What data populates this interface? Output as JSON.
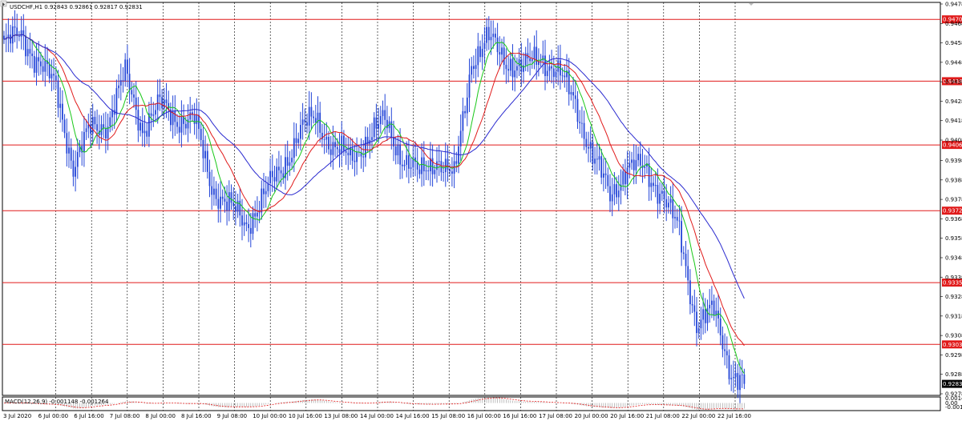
{
  "header": {
    "label": "USDCHF,H1  0.92843 0.92861 0.92817 0.92831"
  },
  "macd_header": {
    "label": "MACD(12,26,9) -0.001148 -0.001264"
  },
  "colors": {
    "candles": "#2547d8",
    "ma_fast": "#19c819",
    "ma_mid": "#e01a1a",
    "ma_slow": "#2a2acf",
    "levels": "#e01a1a",
    "grid": "#000000",
    "macd_hist": "#b0b0b0",
    "macd_signal": "#e01a1a"
  },
  "chart_data": [
    {
      "type": "candlestick",
      "title": "USDCHF,H1",
      "ohlc_last": {
        "open": 0.92843,
        "high": 0.92861,
        "low": 0.92817,
        "close": 0.92831
      },
      "ylim": [
        0.9278,
        0.94785
      ],
      "y_ticks": [
        0.94785,
        0.94685,
        0.94585,
        0.94485,
        0.94385,
        0.94285,
        0.94185,
        0.94085,
        0.9398,
        0.9388,
        0.9378,
        0.9368,
        0.9358,
        0.9348,
        0.9338,
        0.9328,
        0.9318,
        0.9308,
        0.9298,
        0.9288,
        0.9278
      ],
      "y_tick_labels": [
        "0.94785",
        "0.94685",
        "0.94585",
        "0.94485",
        "0.94385",
        "0.94285",
        "0.94185",
        "0.94085",
        "0.93980",
        "0.93880",
        "0.93780",
        "0.93680",
        "0.93580",
        "0.93480",
        "0.93380",
        "0.93280",
        "0.93180",
        "0.93080",
        "0.92980",
        "0.92880",
        "0.92780"
      ],
      "x_tick_labels": [
        "3 Jul 2020",
        "6 Jul 00:00",
        "6 Jul 16:00",
        "7 Jul 08:00",
        "8 Jul 00:00",
        "8 Jul 16:00",
        "9 Jul 08:00",
        "10 Jul 00:00",
        "10 Jul 16:00",
        "13 Jul 08:00",
        "14 Jul 00:00",
        "14 Jul 16:00",
        "15 Jul 08:00",
        "16 Jul 00:00",
        "16 Jul 16:00",
        "17 Jul 08:00",
        "20 Jul 00:00",
        "20 Jul 16:00",
        "21 Jul 08:00",
        "22 Jul 00:00",
        "22 Jul 16:00"
      ],
      "horizontal_levels": [
        {
          "value": 0.94706,
          "label": "0.94706"
        },
        {
          "value": 0.94388,
          "label": "0.94388"
        },
        {
          "value": 0.9406,
          "label": "0.94060"
        },
        {
          "value": 0.93722,
          "label": "0.93722"
        },
        {
          "value": 0.93352,
          "label": "0.93352"
        },
        {
          "value": 0.93034,
          "label": "0.93034"
        }
      ],
      "current_price": {
        "value": 0.92831,
        "label": "0.92831"
      },
      "close_path": {
        "t": [
          0,
          8,
          16,
          24,
          32,
          40,
          48,
          56,
          64,
          72,
          80,
          88,
          96,
          104,
          112,
          120,
          128,
          136,
          144,
          152,
          160,
          168,
          176,
          184,
          192,
          200,
          208,
          216,
          224,
          232,
          240,
          248,
          256,
          264,
          272,
          280,
          288,
          296,
          304,
          312,
          320,
          328,
          336,
          342
        ],
        "close": [
          0.9458,
          0.9462,
          0.9449,
          0.9435,
          0.9395,
          0.9414,
          0.9418,
          0.9442,
          0.9415,
          0.9426,
          0.942,
          0.9418,
          0.9385,
          0.9374,
          0.9365,
          0.938,
          0.9393,
          0.9412,
          0.942,
          0.9405,
          0.9398,
          0.941,
          0.9418,
          0.94,
          0.939,
          0.94,
          0.9388,
          0.945,
          0.946,
          0.945,
          0.9445,
          0.9452,
          0.9443,
          0.9428,
          0.94,
          0.938,
          0.9395,
          0.9393,
          0.9382,
          0.936,
          0.9315,
          0.932,
          0.929,
          0.9283
        ]
      },
      "ma_periods": {
        "fast": 10,
        "mid": 20,
        "slow": 40
      }
    },
    {
      "type": "bar",
      "title": "MACD(12,26,9)",
      "values_text": [
        "-0.001148",
        "-0.001264"
      ],
      "ylim": [
        -0.00189,
        0.00146
      ],
      "y_ticks": [
        0.00146,
        0.0,
        -0.00189
      ],
      "y_tick_labels": [
        "0.001460",
        "0.00",
        "-0.00189"
      ]
    }
  ]
}
